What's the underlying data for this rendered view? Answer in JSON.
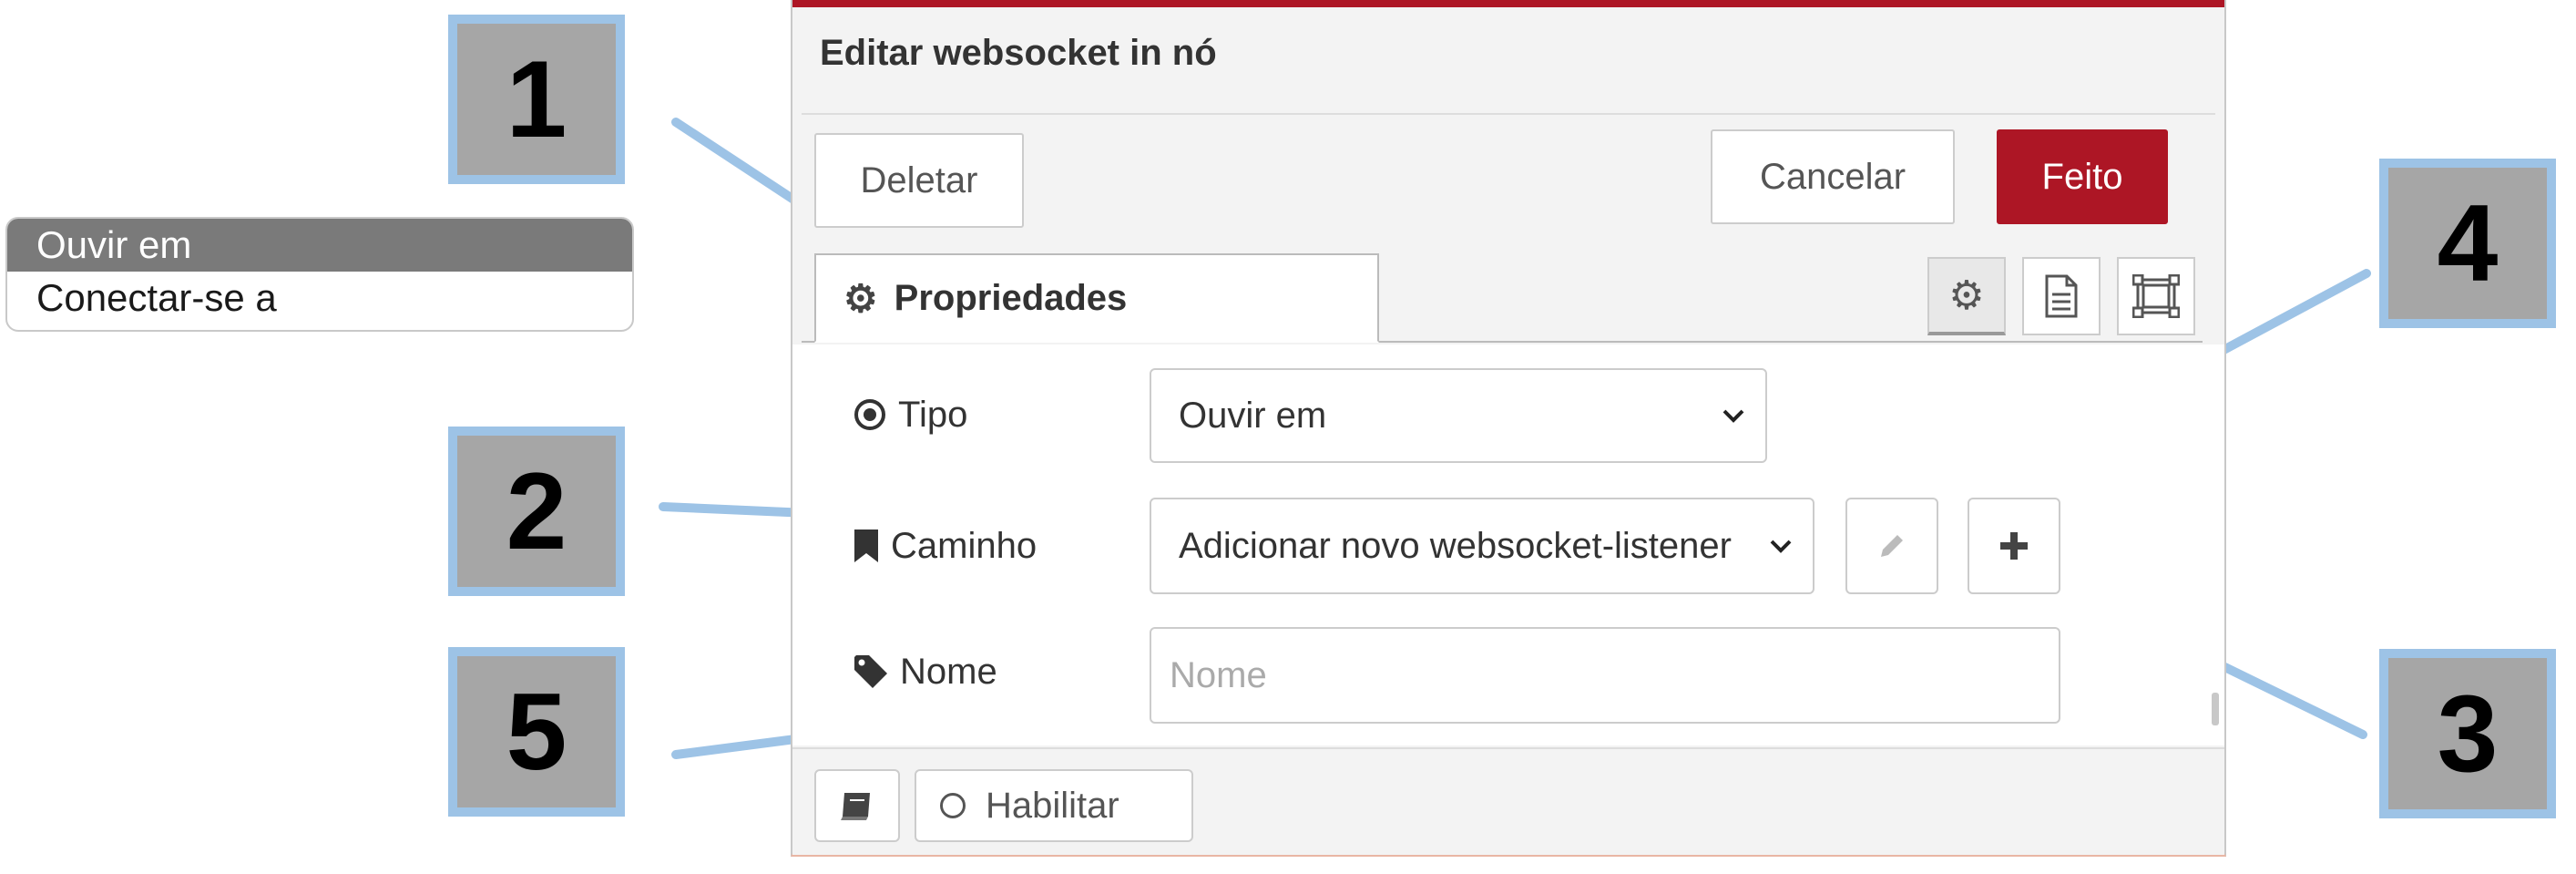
{
  "type_options": [
    "Ouvir em",
    "Conectar-se a"
  ],
  "dialog": {
    "title": "Editar websocket in nó",
    "buttons": {
      "delete": "Deletar",
      "cancel": "Cancelar",
      "done": "Feito"
    },
    "tab": {
      "label": "Propriedades",
      "icon": "gear-icon"
    },
    "tab_icons": [
      "gear-icon",
      "document-icon",
      "frame-icon"
    ],
    "fields": {
      "tipo": {
        "label": "Tipo",
        "icon": "target-icon",
        "value": "Ouvir em"
      },
      "caminho": {
        "label": "Caminho",
        "icon": "bookmark-icon",
        "value": "Adicionar novo websocket-listener"
      },
      "nome": {
        "label": "Nome",
        "icon": "tag-icon",
        "placeholder": "Nome",
        "value": ""
      }
    },
    "footer": {
      "enable_label": "Habilitar"
    }
  },
  "callouts": [
    "1",
    "2",
    "3",
    "4",
    "5"
  ],
  "colors": {
    "accent": "#ad1625",
    "callout_border": "#9dc3e6",
    "callout_fill": "#a6a6a6"
  }
}
